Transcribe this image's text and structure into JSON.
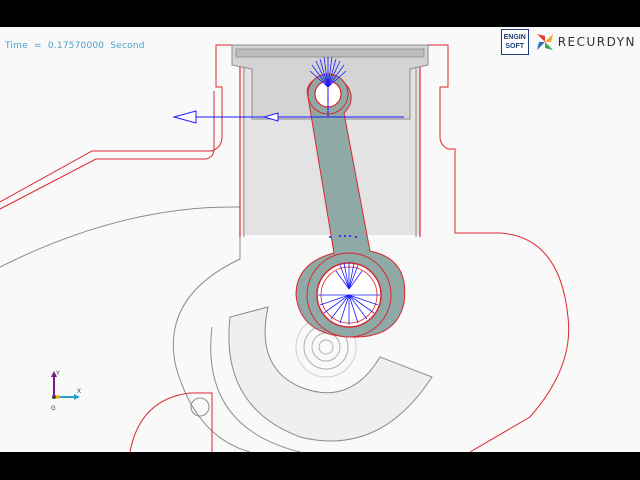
{
  "window": {
    "background": "#f9f9f9",
    "letterbox": "#000000"
  },
  "time_readout": {
    "label": "Time",
    "equals": "=",
    "value": "0.17570000",
    "unit": "Second"
  },
  "logos": {
    "enginsoft_line1": "ENGIN",
    "enginsoft_line2": "SOFT",
    "recurdyn_text": "RECURDYN"
  },
  "axis_triad": {
    "x_label": "X",
    "y_label": "Y",
    "z_label": "G"
  },
  "colors": {
    "outline_red": "#d9282f",
    "outline_gray": "#8c8c8c",
    "rod_fill": "#8fa9a6",
    "force_blue": "#1a1aff",
    "piston_fill": "#dcdcdc"
  },
  "icons": {
    "enginsoft": "enginsoft-logo",
    "recurdyn": "recurdyn-pinwheel-icon",
    "triad": "coordinate-axes-icon"
  }
}
